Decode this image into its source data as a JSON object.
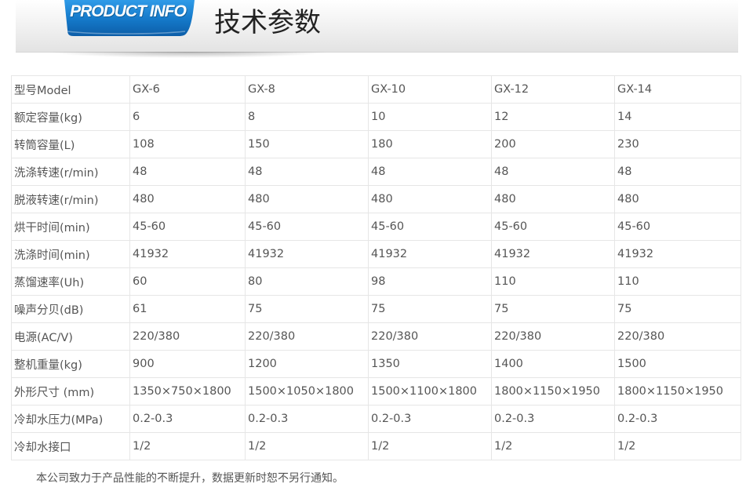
{
  "header": {
    "badge_text": "PRODUCT INFO",
    "title": "技术参数",
    "badge_color": "#1478c8"
  },
  "spec_table": {
    "rows": [
      [
        "型号Model",
        "GX-6",
        "GX-8",
        "GX-10",
        "GX-12",
        "GX-14"
      ],
      [
        "额定容量(kg)",
        "6",
        "8",
        "10",
        "12",
        "14"
      ],
      [
        "转筒容量(L)",
        "108",
        "150",
        "180",
        "200",
        "230"
      ],
      [
        "洗涤转速(r/min)",
        "48",
        "48",
        "48",
        "48",
        "48"
      ],
      [
        "脱液转速(r/min)",
        "480",
        "480",
        "480",
        "480",
        "480"
      ],
      [
        "烘干时间(min)",
        "45-60",
        "45-60",
        "45-60",
        "45-60",
        "45-60"
      ],
      [
        "洗涤时间(min)",
        "41932",
        "41932",
        "41932",
        "41932",
        "41932"
      ],
      [
        "蒸馏速率(Uh)",
        "60",
        "80",
        "98",
        "110",
        "110"
      ],
      [
        "噪声分贝(dB)",
        "61",
        "75",
        "75",
        "75",
        "75"
      ],
      [
        "电源(AC/V)",
        "220/380",
        "220/380",
        "220/380",
        "220/380",
        "220/380"
      ],
      [
        "整机重量(kg)",
        "900",
        "1200",
        "1350",
        "1400",
        "1500"
      ],
      [
        "外形尺寸 (mm)",
        "1350×750×1800",
        "1500×1050×1800",
        "1500×1100×1800",
        "1800×1150×1950",
        "1800×1150×1950"
      ],
      [
        "冷却水压力(MPa)",
        "0.2-0.3",
        "0.2-0.3",
        "0.2-0.3",
        "0.2-0.3",
        "0.2-0.3"
      ],
      [
        "冷却水接口",
        "1/2",
        "1/2",
        "1/2",
        "1/2",
        "1/2"
      ]
    ]
  },
  "footnote": "本公司致力于产品性能的不断提升，数据更新时恕不另行通知。"
}
